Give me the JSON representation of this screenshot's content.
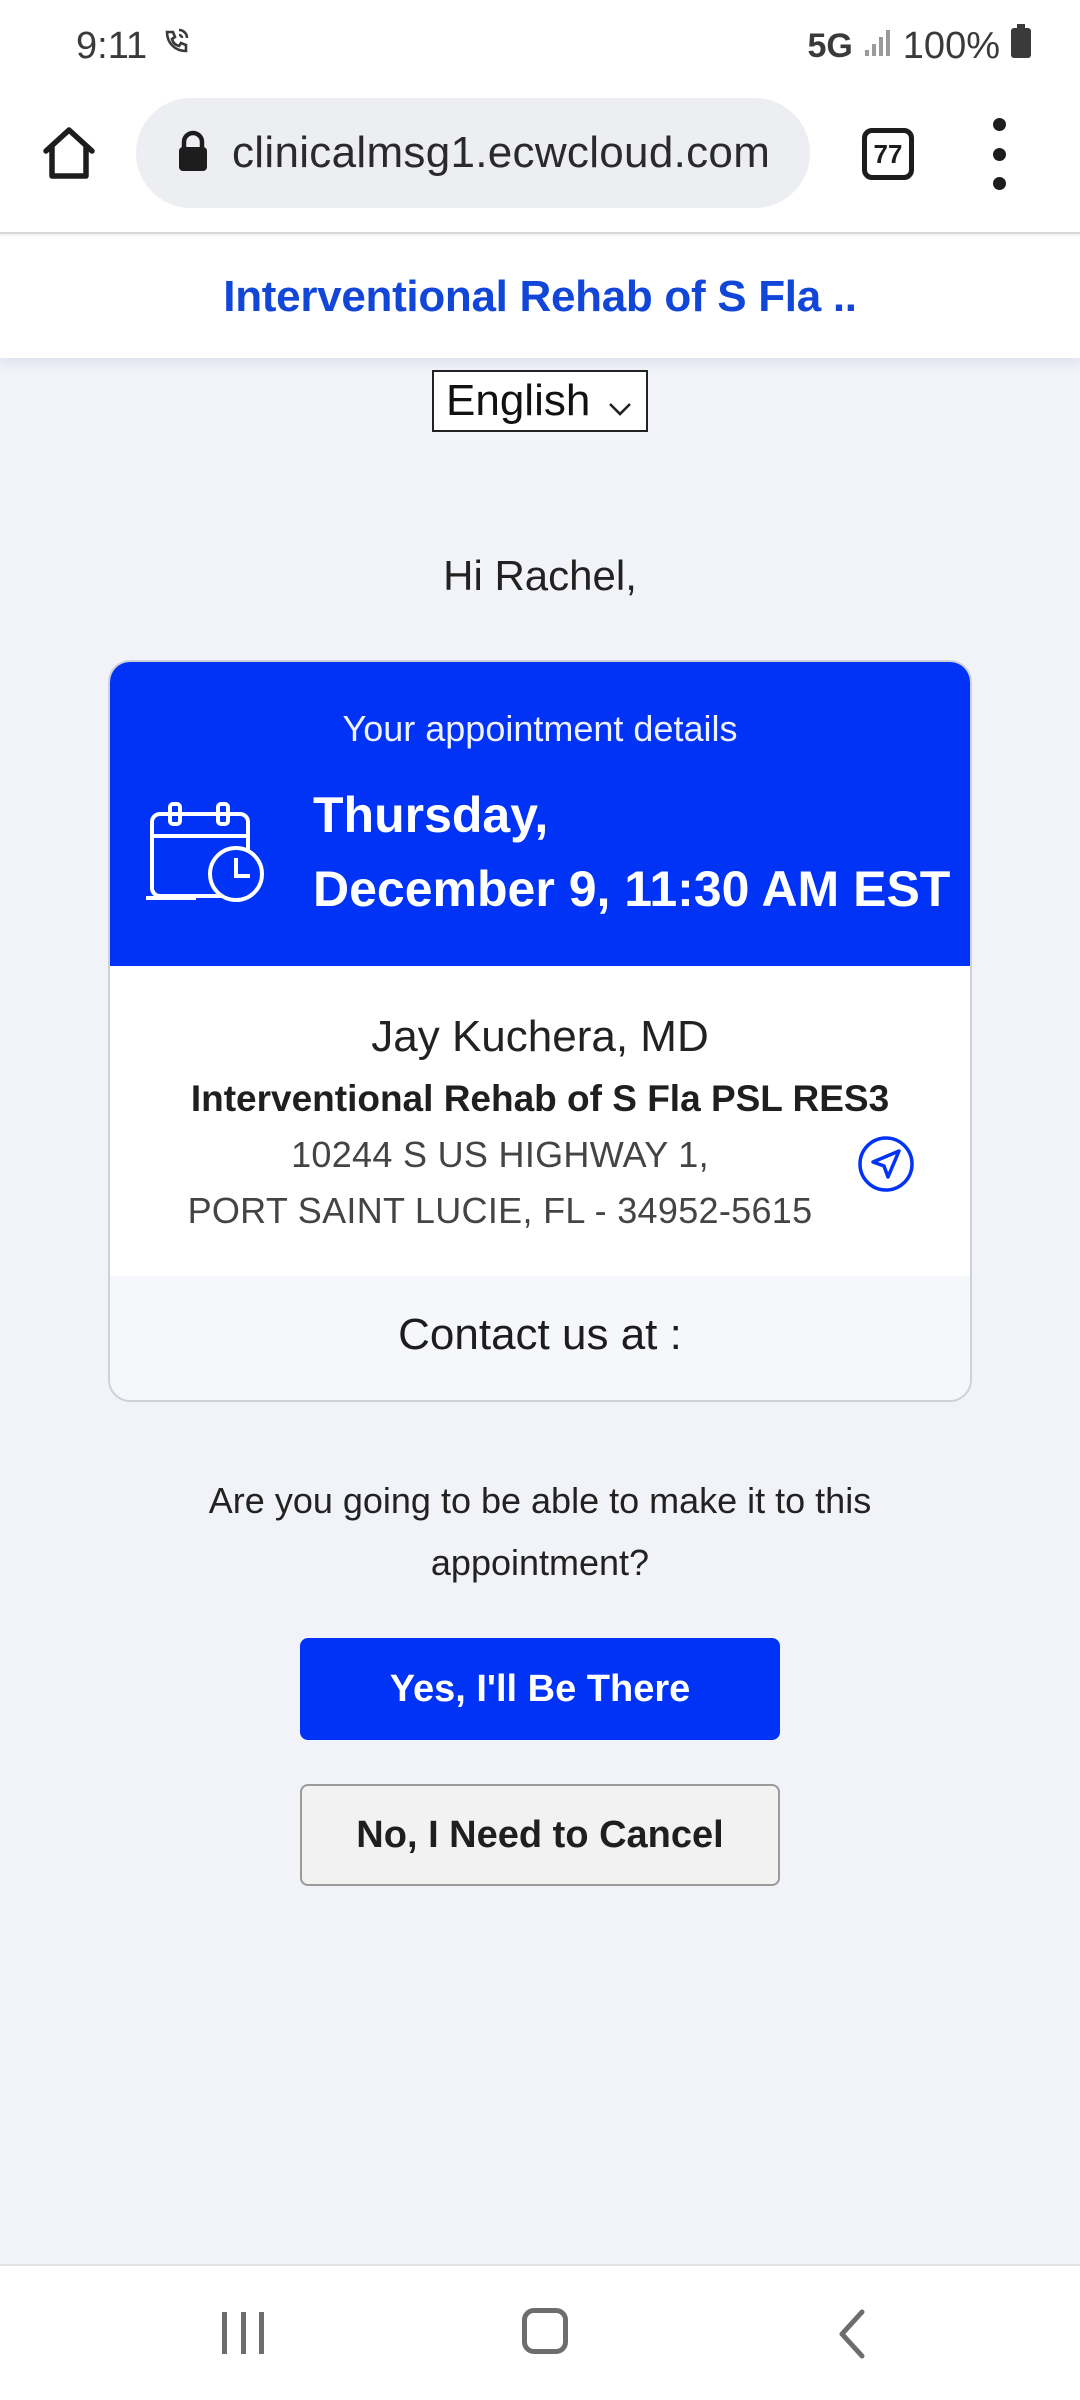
{
  "status_bar": {
    "time": "9:11",
    "network": "5G",
    "battery": "100%",
    "icons": [
      "wifi-calling-icon",
      "signal-icon",
      "battery-icon"
    ]
  },
  "browser": {
    "url": "clinicalmsg1.ecwcloud.com",
    "tab_count": "77",
    "icons": [
      "home-icon",
      "lock-icon",
      "tabs-icon",
      "more-vert-icon"
    ]
  },
  "header": {
    "title": "Interventional Rehab of S Fla .."
  },
  "language": {
    "selected": "English"
  },
  "greeting": "Hi Rachel,",
  "appointment": {
    "label": "Your appointment details",
    "day": "Thursday,",
    "datetime": "December 9, 11:30 AM EST",
    "provider": "Jay Kuchera, MD",
    "facility": "Interventional Rehab of S Fla PSL RES3",
    "address_line1": "10244 S US HIGHWAY 1,",
    "address_line2": "PORT SAINT LUCIE, FL - 34952-5615",
    "contact_label": "Contact us at :"
  },
  "question": "Are you going to be able to make it to this appointment?",
  "actions": {
    "confirm_label": "Yes, I'll Be There",
    "cancel_label": "No, I Need to Cancel"
  },
  "colors": {
    "brand_blue": "#0033f5",
    "header_title": "#1246d8",
    "page_bg": "#f1f3f8"
  }
}
